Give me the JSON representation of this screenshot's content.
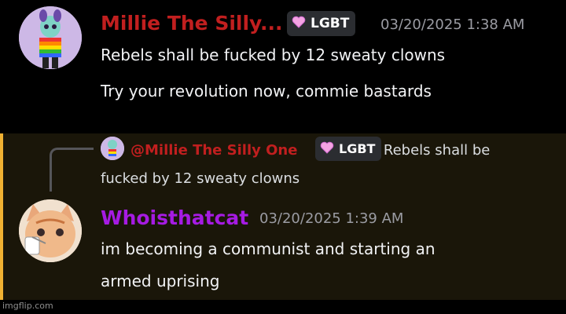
{
  "message1": {
    "author": "Millie The Silly...",
    "role_tag": "LGBT",
    "timestamp": "03/20/2025 1:38 AM",
    "lines": [
      "Rebels shall be fucked by 12 sweaty clowns",
      "Try your revolution now, commie bastards"
    ]
  },
  "reply_preview": {
    "mention": "@Millie The Silly One",
    "role_tag": "LGBT",
    "text_part1": "Rebels shall be",
    "text_part2": "fucked by 12 sweaty clowns"
  },
  "message2": {
    "author": "Whoisthatcat",
    "timestamp": "03/20/2025 1:39 AM",
    "lines": [
      "im becoming a communist and starting an",
      "armed uprising"
    ]
  },
  "watermark": "imgflip.com",
  "colors": {
    "author1": "#c11f1f",
    "author2": "#a61be3",
    "mention_bar": "#f0b132",
    "mention_bg": "#1a1609",
    "tag_bg": "#2b2d31"
  },
  "icons": [
    "avatar-millie",
    "avatar-whoisthatcat",
    "heart-icon"
  ]
}
